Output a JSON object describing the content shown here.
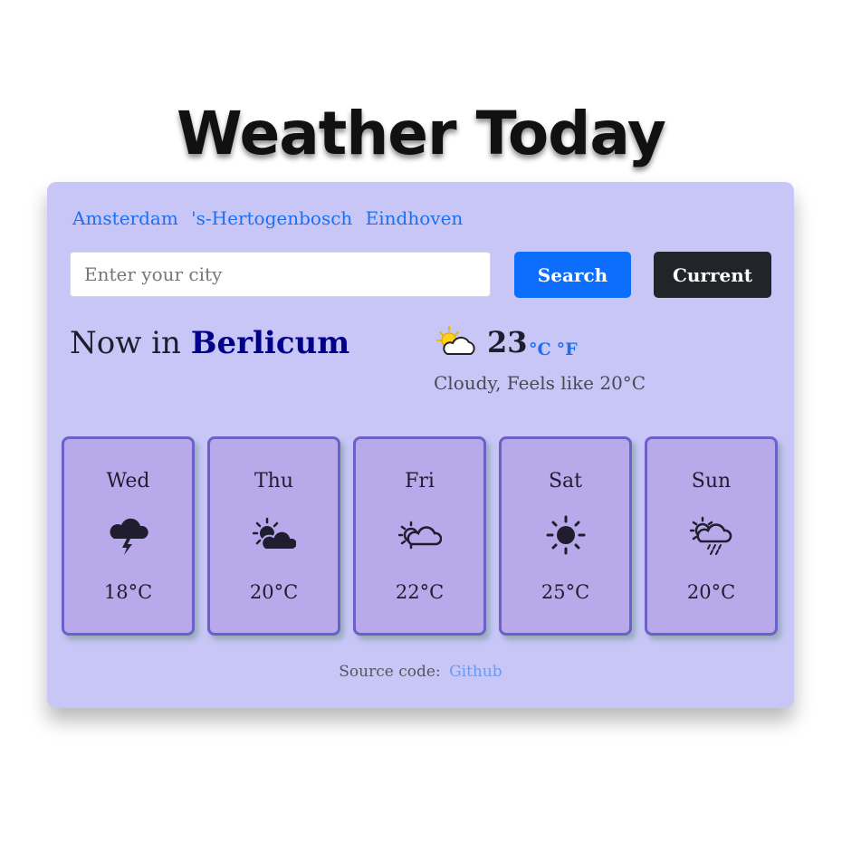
{
  "app": {
    "title": "Weather Today"
  },
  "quick_cities": [
    "Amsterdam",
    "'s-Hertogenbosch",
    "Eindhoven"
  ],
  "search": {
    "placeholder": "Enter your city",
    "value": "",
    "button_label": "Search",
    "current_label": "Current"
  },
  "current": {
    "prefix": "Now in",
    "city": "Berlicum",
    "temperature": "23",
    "unit_c": "°C",
    "unit_f": "°F",
    "description": "Cloudy, Feels like 20°C",
    "icon": "partly-cloudy-icon"
  },
  "forecast": [
    {
      "day": "Wed",
      "temp": "18°C",
      "icon": "thunderstorm-icon"
    },
    {
      "day": "Thu",
      "temp": "20°C",
      "icon": "partly-sunny-icon"
    },
    {
      "day": "Fri",
      "temp": "22°C",
      "icon": "sun-behind-cloud-icon"
    },
    {
      "day": "Sat",
      "temp": "25°C",
      "icon": "sun-icon"
    },
    {
      "day": "Sun",
      "temp": "20°C",
      "icon": "sun-cloud-rain-icon"
    }
  ],
  "footer": {
    "label": "Source code:",
    "link": "Github"
  },
  "colors": {
    "card_bg": "#c8c6f7",
    "forecast_bg": "#b8a9ea",
    "forecast_border": "#6b61c9",
    "accent": "#0d6efd",
    "city_color": "#00008b",
    "dark_button": "#212529"
  }
}
